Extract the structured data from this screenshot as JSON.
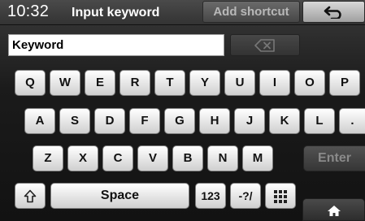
{
  "status": {
    "time": "10:32"
  },
  "header": {
    "title": "Input keyword",
    "shortcut_label": "Add shortcut",
    "back_icon": "back-arrow-icon"
  },
  "input": {
    "value": "Keyword",
    "delete_icon": "backspace-icon"
  },
  "keyboard": {
    "row1": [
      "Q",
      "W",
      "E",
      "R",
      "T",
      "Y",
      "U",
      "I",
      "O",
      "P"
    ],
    "row2": [
      "A",
      "S",
      "D",
      "F",
      "G",
      "H",
      "J",
      "K",
      "L",
      "."
    ],
    "row3": [
      "Z",
      "X",
      "C",
      "V",
      "B",
      "N",
      "M"
    ],
    "enter_label": "Enter",
    "shift_icon": "shift-arrow-icon",
    "space_label": "Space",
    "numbers_label": "123",
    "symbols_label": "-?/",
    "grid_icon": "grid-icon",
    "home_icon": "home-icon"
  }
}
